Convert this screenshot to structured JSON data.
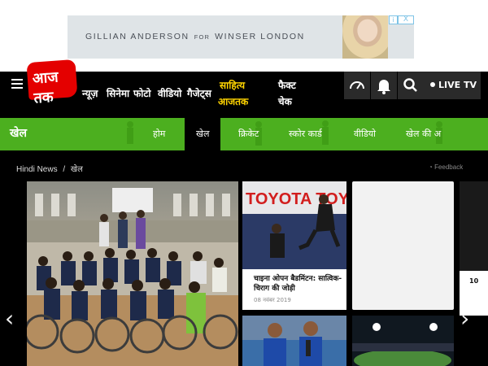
{
  "ad": {
    "text_brand": "GILLIAN ANDERSON",
    "text_for": "FOR",
    "text_product": "WINSER LONDON",
    "close_label": "X",
    "info_label": "i"
  },
  "header": {
    "logo_text": "आज तक",
    "nav": [
      "न्यूज़",
      "सिनेमा",
      "फोटो",
      "वीडियो",
      "गैजेट्स"
    ],
    "sahitya_line1": "साहित्य",
    "sahitya_line2": "आजतक",
    "fact_line1": "फैक्ट",
    "fact_line2": "चेक",
    "live_label": "LIVE TV"
  },
  "sports": {
    "title": "खेल",
    "tabs": [
      "होम",
      "खेल",
      "क्रिकेट",
      "स्कोर कार्ड",
      "वीडियो",
      "खेल की अ"
    ],
    "active_tab": "खेल"
  },
  "breadcrumb": {
    "home": "Hindi News",
    "separator": "/",
    "current": "खेल"
  },
  "feedback_label": "Feedback",
  "card1": {
    "title": "चाइना ओपन बैडमिंटन: सात्विक-चिराग की जोड़ी",
    "date": "08 नवंबर 2019",
    "banner_text": "TOYOTA TOYO"
  },
  "side_peek_text": "10",
  "colors": {
    "topnav_bg": "#000000",
    "sports_green": "#4caf1f",
    "logo_red": "#e40000",
    "sahitya_yellow": "#ffd400"
  },
  "icons": [
    "hamburger-icon",
    "speedometer-icon",
    "bell-icon",
    "search-icon",
    "left-arrow-icon",
    "right-arrow-icon",
    "feedback-icon"
  ]
}
